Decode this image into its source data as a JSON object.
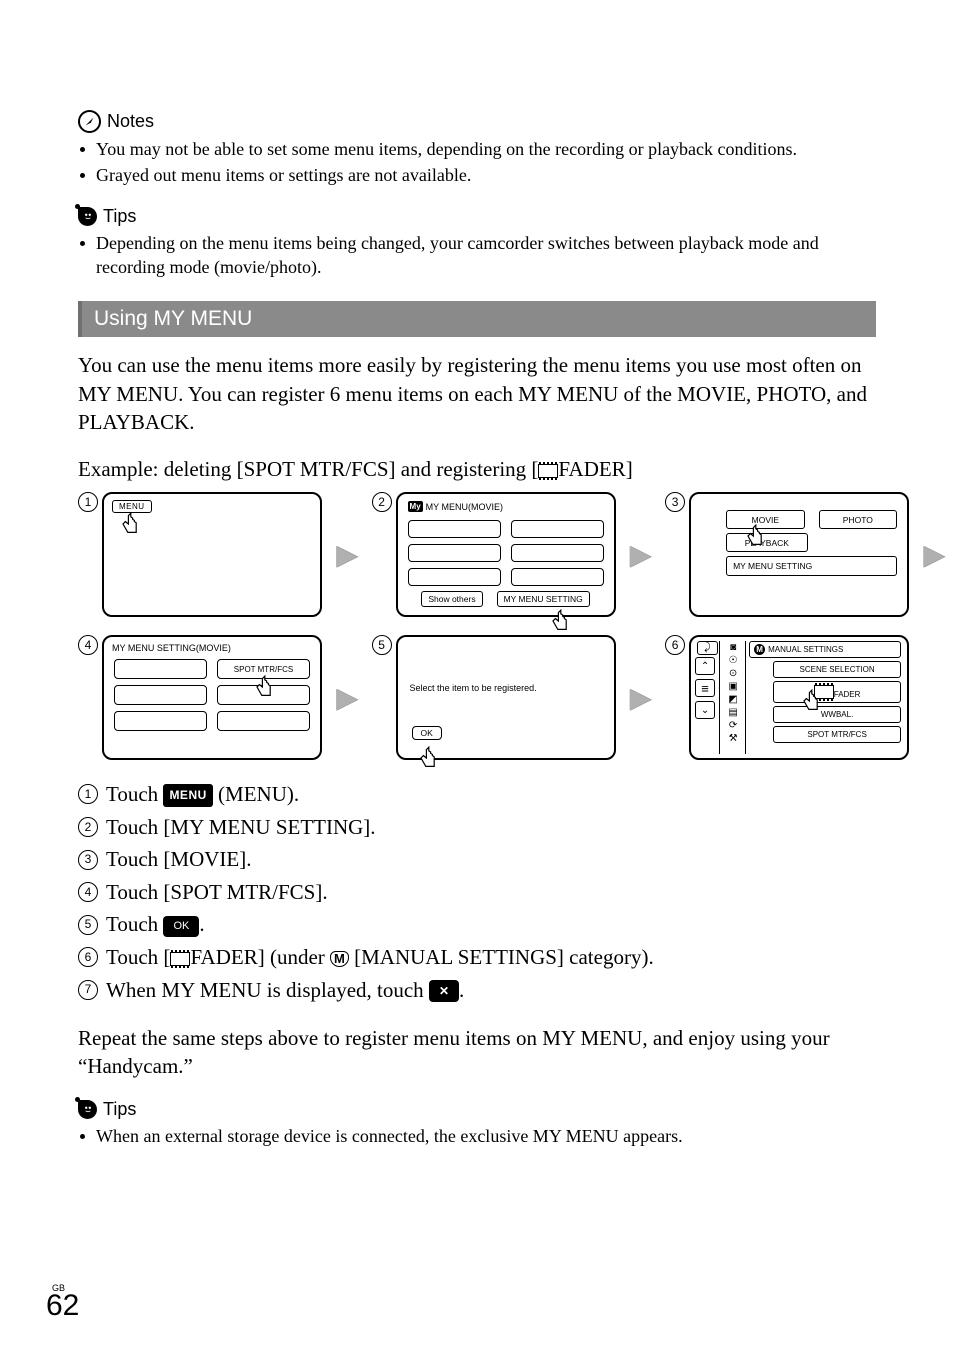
{
  "notes": {
    "heading": "Notes",
    "items": [
      "You may not be able to set some menu items, depending on the recording or playback conditions.",
      "Grayed out menu items or settings are not available."
    ]
  },
  "tips1": {
    "heading": "Tips",
    "items": [
      "Depending on the menu items being changed, your camcorder switches between playback mode and recording mode (movie/photo)."
    ]
  },
  "section_title": "Using MY MENU",
  "intro": "You can use the menu items more easily by registering the menu items you use most often on MY MENU. You can register 6 menu items on each MY MENU of the MOVIE, PHOTO, and PLAYBACK.",
  "example_prefix": "Example: deleting [SPOT MTR/FCS] and registering [",
  "example_suffix": "FADER]",
  "screens": {
    "s1": {
      "menu_label": "MENU"
    },
    "s2": {
      "title_badge": "My",
      "title_text": "MY MENU(MOVIE)",
      "btn_show_others": "Show others",
      "btn_my_menu_setting": "MY MENU SETTING"
    },
    "s3": {
      "movie": "MOVIE",
      "photo": "PHOTO",
      "playback": "PLAYBACK",
      "my_menu_setting": "MY MENU SETTING"
    },
    "s4": {
      "title": "MY MENU SETTING(MOVIE)",
      "spot": "SPOT MTR/FCS"
    },
    "s5": {
      "text": "Select the item to be registered.",
      "ok": "OK"
    },
    "s6": {
      "manual_settings": "MANUAL SETTINGS",
      "scene_selection": "SCENE SELECTION",
      "fader": "FADER",
      "wbal": "WBAL.",
      "spot": "SPOT MTR/FCS"
    }
  },
  "steps": {
    "s1a": "Touch ",
    "s1b": " (MENU).",
    "s1_badge": "MENU",
    "s2": "Touch [MY MENU SETTING].",
    "s3": "Touch [MOVIE].",
    "s4": "Touch [SPOT MTR/FCS].",
    "s5a": "Touch ",
    "s5b": ".",
    "s5_badge": "OK",
    "s6a": "Touch [",
    "s6b": "FADER] (under ",
    "s6c": " [MANUAL SETTINGS] category).",
    "s6_chip": "M",
    "s7a": "When MY MENU is displayed, touch ",
    "s7b": ".",
    "s7_badge": "✕"
  },
  "repeat": "Repeat the same steps above to register menu items on MY MENU, and enjoy using your “Handycam.”",
  "tips2": {
    "heading": "Tips",
    "items": [
      "When an external storage device is connected, the exclusive MY MENU appears."
    ]
  },
  "page": {
    "gb": "GB",
    "num": "62"
  }
}
